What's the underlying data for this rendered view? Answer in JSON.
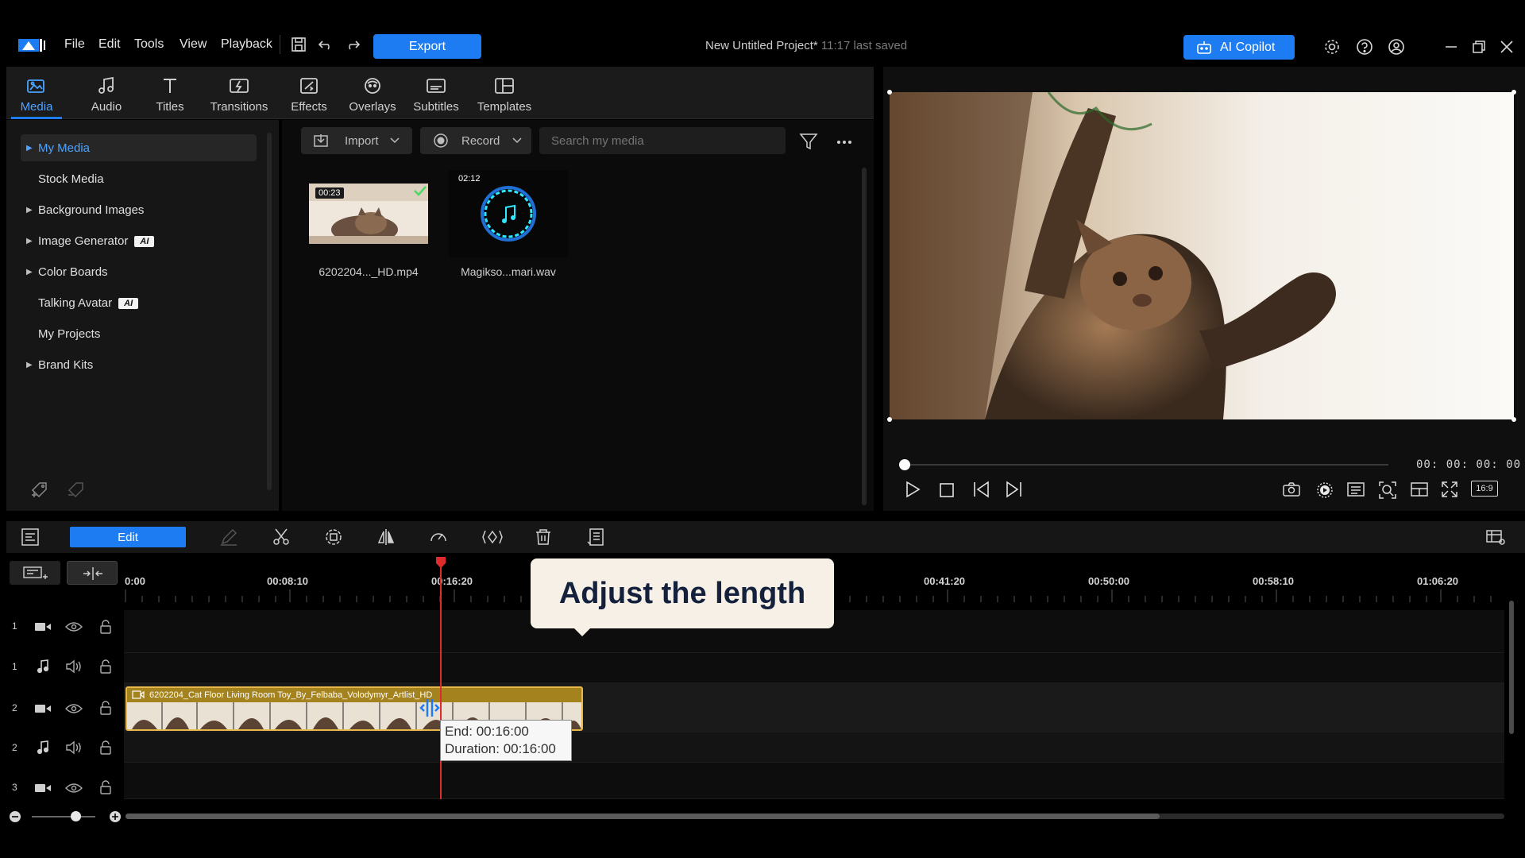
{
  "menu": [
    "File",
    "Edit",
    "Tools",
    "View",
    "Playback"
  ],
  "toolbar": {
    "export_label": "Export"
  },
  "project": {
    "title": "New Untitled Project*",
    "saved": "11:17 last saved"
  },
  "ai_copilot": {
    "label": "AI Copilot"
  },
  "media_tabs": [
    {
      "label": "Media",
      "icon": "media-icon"
    },
    {
      "label": "Audio",
      "icon": "music-note-icon"
    },
    {
      "label": "Titles",
      "icon": "titles-icon"
    },
    {
      "label": "Transitions",
      "icon": "transitions-icon"
    },
    {
      "label": "Effects",
      "icon": "effects-icon"
    },
    {
      "label": "Overlays",
      "icon": "overlays-icon"
    },
    {
      "label": "Subtitles",
      "icon": "subtitles-icon"
    },
    {
      "label": "Templates",
      "icon": "templates-icon"
    }
  ],
  "sidebar": {
    "items": [
      {
        "label": "My Media",
        "expandable": true,
        "selected": true
      },
      {
        "label": "Stock Media",
        "expandable": false
      },
      {
        "label": "Background Images",
        "expandable": true
      },
      {
        "label": "Image Generator",
        "expandable": true,
        "badge": "AI"
      },
      {
        "label": "Color Boards",
        "expandable": true
      },
      {
        "label": "Talking Avatar",
        "expandable": false,
        "badge": "AI"
      },
      {
        "label": "My Projects",
        "expandable": false
      },
      {
        "label": "Brand Kits",
        "expandable": true
      }
    ]
  },
  "media_toolbar": {
    "import_label": "Import",
    "record_label": "Record",
    "search_placeholder": "Search my media"
  },
  "media_items": [
    {
      "name": "6202204..._HD.mp4",
      "duration": "00:23",
      "used": true
    },
    {
      "name": "Magikso...mari.wav",
      "duration": "02:12"
    }
  ],
  "preview": {
    "timecode": "00: 00: 00: 00",
    "aspect": "16:9"
  },
  "timeline": {
    "edit_label": "Edit",
    "ruler": [
      "0:00",
      "00:08:10",
      "00:16:20",
      "00:41:20",
      "00:50:00",
      "00:58:10",
      "01:06:20"
    ],
    "tracks": [
      {
        "num": "1",
        "type": "video"
      },
      {
        "num": "1",
        "type": "audio"
      },
      {
        "num": "2",
        "type": "video"
      },
      {
        "num": "2",
        "type": "audio"
      },
      {
        "num": "3",
        "type": "video"
      }
    ],
    "clip": {
      "title": "6202204_Cat Floor Living Room Toy_By_Felbaba_Volodymyr_Artlist_HD"
    },
    "tooltip": {
      "end": "End: 00:16:00",
      "duration": "Duration: 00:16:00"
    },
    "callout": "Adjust the length"
  },
  "colors": {
    "accent": "#1e7cf2",
    "clip": "#e8b74a",
    "playhead": "#e02b2b"
  }
}
